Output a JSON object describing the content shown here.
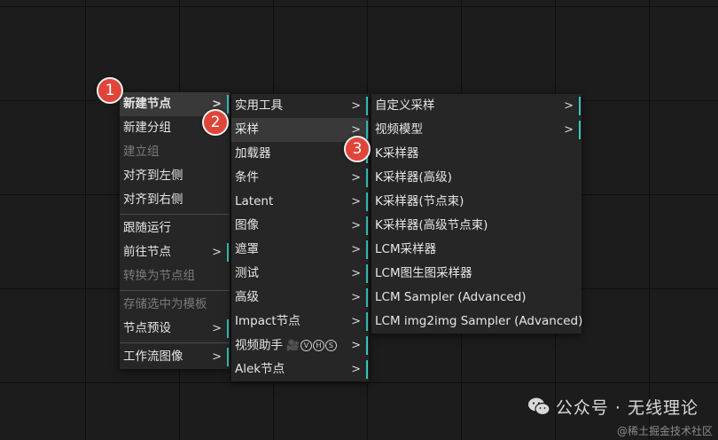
{
  "menu1": {
    "items": [
      {
        "label": "新建节点",
        "arrow": ">",
        "bar": true,
        "state": "active"
      },
      {
        "label": "新建分组"
      },
      {
        "label": "建立组",
        "state": "disabled"
      },
      {
        "label": "对齐到左侧"
      },
      {
        "label": "对齐到右侧"
      },
      {
        "label": "跟随运行"
      },
      {
        "label": "前往节点",
        "arrow": ">",
        "bar": true
      },
      {
        "label": "转换为节点组",
        "state": "disabled"
      },
      {
        "label": "存储选中为模板",
        "state": "disabled"
      },
      {
        "label": "节点预设",
        "arrow": ">",
        "bar": true
      },
      {
        "label": "工作流图像",
        "arrow": ">",
        "bar": true
      }
    ]
  },
  "menu2": {
    "items": [
      {
        "label": "实用工具",
        "arrow": ">",
        "bar": true
      },
      {
        "label": "采样",
        "arrow": ">",
        "bar": true,
        "state": "active"
      },
      {
        "label": "加载器",
        "arrow": ">",
        "bar": true
      },
      {
        "label": "条件",
        "arrow": ">",
        "bar": true
      },
      {
        "label": "Latent",
        "arrow": ">",
        "bar": true
      },
      {
        "label": "图像",
        "arrow": ">",
        "bar": true
      },
      {
        "label": "遮罩",
        "arrow": ">",
        "bar": true
      },
      {
        "label": "测试",
        "arrow": ">",
        "bar": true
      },
      {
        "label": "高级",
        "arrow": ">",
        "bar": true
      },
      {
        "label": "Impact节点",
        "arrow": ">",
        "bar": true
      },
      {
        "label": "视频助手",
        "arrow": ">",
        "bar": true,
        "badge_icons": [
          "camera-icon",
          "V",
          "H",
          "S"
        ]
      },
      {
        "label": "Alek节点",
        "arrow": ">",
        "bar": true
      }
    ]
  },
  "menu3": {
    "items": [
      {
        "label": "自定义采样",
        "arrow": ">",
        "bar": true
      },
      {
        "label": "视频模型",
        "arrow": ">",
        "bar": true
      },
      {
        "label": "K采样器"
      },
      {
        "label": "K采样器(高级)"
      },
      {
        "label": "K采样器(节点束)"
      },
      {
        "label": "K采样器(高级节点束)"
      },
      {
        "label": "LCM采样器"
      },
      {
        "label": "LCM图生图采样器"
      },
      {
        "label": "LCM Sampler (Advanced)"
      },
      {
        "label": "LCM img2img Sampler (Advanced)"
      }
    ]
  },
  "steps": [
    "1",
    "2",
    "3"
  ],
  "watermark": {
    "text": "公众号 · 无线理论",
    "sub": "@稀土掘金技术社区"
  },
  "colors": {
    "accent": "#39c5c0",
    "badge": "#e0453a",
    "menu_bg": "#262626",
    "canvas_bg": "#1c1c1c"
  }
}
